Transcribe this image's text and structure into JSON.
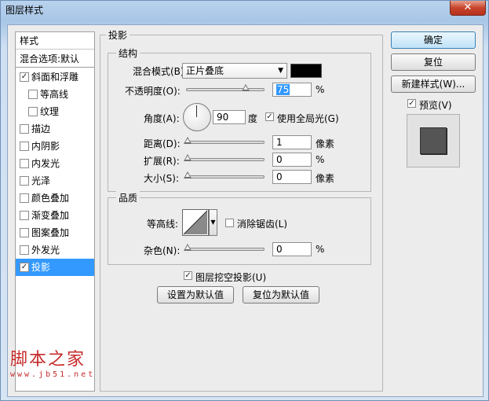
{
  "window": {
    "title": "图层样式",
    "close_symbol": "✕"
  },
  "sidebar": {
    "header": "样式",
    "blend_options": "混合选项:默认",
    "items": [
      {
        "label": "斜面和浮雕",
        "checked": true
      },
      {
        "label": "等高线",
        "checked": false,
        "sub": true
      },
      {
        "label": "纹理",
        "checked": false,
        "sub": true
      },
      {
        "label": "描边",
        "checked": false
      },
      {
        "label": "内阴影",
        "checked": false
      },
      {
        "label": "内发光",
        "checked": false
      },
      {
        "label": "光泽",
        "checked": false
      },
      {
        "label": "颜色叠加",
        "checked": false
      },
      {
        "label": "渐变叠加",
        "checked": false
      },
      {
        "label": "图案叠加",
        "checked": false
      },
      {
        "label": "外发光",
        "checked": false
      },
      {
        "label": "投影",
        "checked": true,
        "selected": true
      }
    ]
  },
  "panel": {
    "title": "投影",
    "structure": {
      "title": "结构",
      "blend_mode_label": "混合模式(B):",
      "blend_mode_value": "正片叠底",
      "shadow_color": "#000000",
      "opacity_label": "不透明度(O):",
      "opacity_value": "75",
      "opacity_unit": "%",
      "opacity_fraction": 0.75,
      "angle_label": "角度(A):",
      "angle_value": "90",
      "angle_unit": "度",
      "global_light_label": "使用全局光(G)",
      "global_light_checked": true,
      "distance_label": "距离(D):",
      "distance_value": "1",
      "distance_unit": "像素",
      "spread_label": "扩展(R):",
      "spread_value": "0",
      "spread_unit": "%",
      "size_label": "大小(S):",
      "size_value": "0",
      "size_unit": "像素"
    },
    "quality": {
      "title": "品质",
      "contour_label": "等高线:",
      "anti_alias_label": "消除锯齿(L)",
      "anti_alias_checked": false,
      "noise_label": "杂色(N):",
      "noise_value": "0",
      "noise_unit": "%"
    },
    "knockout_label": "图层挖空投影(U)",
    "knockout_checked": true,
    "make_default_label": "设置为默认值",
    "reset_default_label": "复位为默认值"
  },
  "buttons": {
    "ok_label": "确定",
    "reset_label": "复位",
    "new_style_label": "新建样式(W)...",
    "preview_label": "预览(V)",
    "preview_checked": true
  },
  "watermark": {
    "text": "脚本之家",
    "url": "www.jb51.net"
  },
  "colors": {
    "selection": "#3399ff",
    "accent": "#3c7fb1",
    "watermark": "#c62b2b"
  }
}
